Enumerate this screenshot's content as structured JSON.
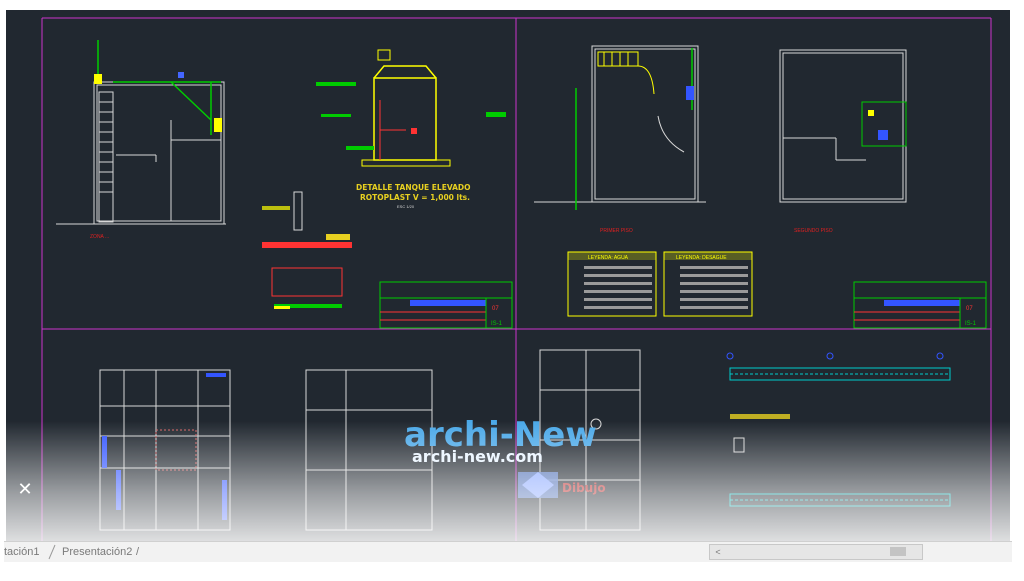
{
  "viewport": {
    "background": "#212830",
    "sheet_border_color": "#cc33cc"
  },
  "drawings": {
    "tank_detail_title": "DETALLE TANQUE ELEVADO",
    "tank_detail_subtitle": "ROTOPLAST  V = 1,000 lts.",
    "tank_detail_scale": "ESC 1/20",
    "label_red_1": "ZONA ...",
    "label_red_2": "PRIMER PISO",
    "label_red_3": "SEGUNDO PISO",
    "legend_water_title": "LEYENDA: AGUA",
    "legend_drain_title": "LEYENDA: DESAGUE",
    "title_block_sheet_1": "IS-1",
    "title_block_sheet_2": "IS-1",
    "title_block_num_1": "07",
    "title_block_num_2": "07"
  },
  "watermark": {
    "brand": "archi-New",
    "url": "archi-new.com",
    "sub_brand": "Dibujo"
  },
  "ui": {
    "close_icon": "close-icon",
    "tabs": [
      {
        "label": "tación1"
      },
      {
        "label": "Presentación2"
      }
    ],
    "tab_add": "/"
  }
}
